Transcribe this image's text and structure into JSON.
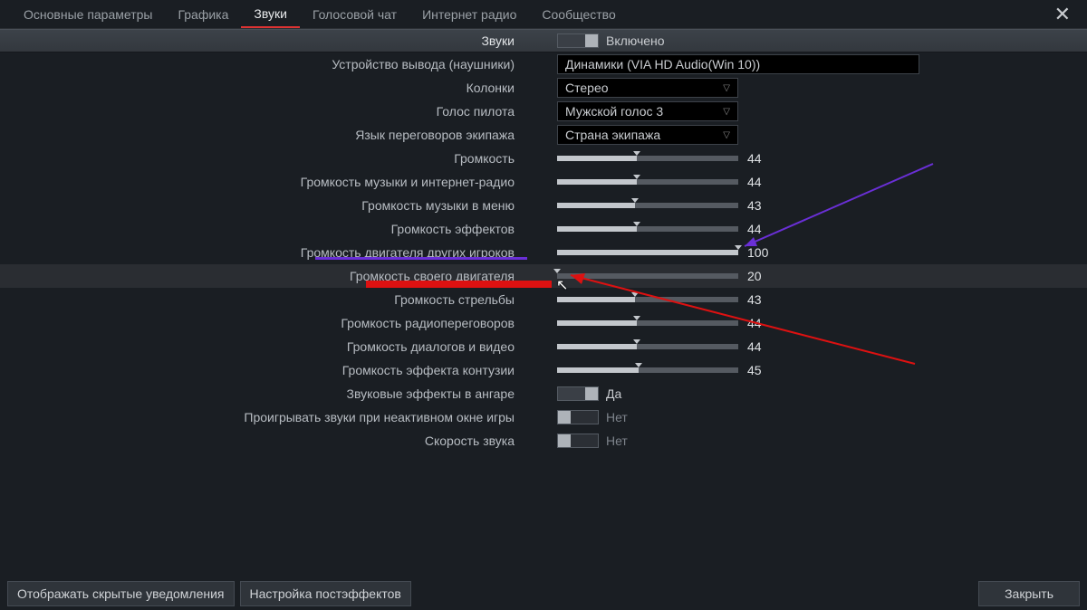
{
  "tabs": [
    "Основные параметры",
    "Графика",
    "Звуки",
    "Голосовой чат",
    "Интернет радио",
    "Сообщество"
  ],
  "activeTab": 2,
  "headerLabel": "Звуки",
  "headerSwitchLabel": "Включено",
  "rows": [
    {
      "label": "Устройство вывода (наушники)",
      "type": "dropdown",
      "value": "Динамики (VIA HD Audio(Win 10))",
      "wide": true
    },
    {
      "label": "Колонки",
      "type": "dropdown",
      "value": "Стерео"
    },
    {
      "label": "Голос пилота",
      "type": "dropdown",
      "value": "Мужской голос 3"
    },
    {
      "label": "Язык переговоров экипажа",
      "type": "dropdown",
      "value": "Страна экипажа"
    },
    {
      "label": "Громкость",
      "type": "slider",
      "value": 44
    },
    {
      "label": "Громкость музыки и интернет-радио",
      "type": "slider",
      "value": 44
    },
    {
      "label": "Громкость музыки в меню",
      "type": "slider",
      "value": 43
    },
    {
      "label": "Громкость эффектов",
      "type": "slider",
      "value": 44
    },
    {
      "label": "Громкость двигателя других игроков",
      "type": "slider",
      "value": 100
    },
    {
      "label": "Громкость своего двигателя",
      "type": "slider",
      "value": 20,
      "highlight": true,
      "fillShown": 0
    },
    {
      "label": "Громкость стрельбы",
      "type": "slider",
      "value": 43
    },
    {
      "label": "Громкость радиопереговоров",
      "type": "slider",
      "value": 44
    },
    {
      "label": "Громкость диалогов и видео",
      "type": "slider",
      "value": 44
    },
    {
      "label": "Громкость эффекта контузии",
      "type": "slider",
      "value": 45
    },
    {
      "label": "Звуковые эффекты в ангаре",
      "type": "switch",
      "on": true,
      "text": "Да"
    },
    {
      "label": "Проигрывать звуки при неактивном окне игры",
      "type": "switch",
      "on": false,
      "text": "Нет"
    },
    {
      "label": "Скорость звука",
      "type": "switch",
      "on": false,
      "text": "Нет"
    }
  ],
  "footer": {
    "btn1": "Отображать скрытые уведомления",
    "btn2": "Настройка постэффектов",
    "close": "Закрыть"
  }
}
